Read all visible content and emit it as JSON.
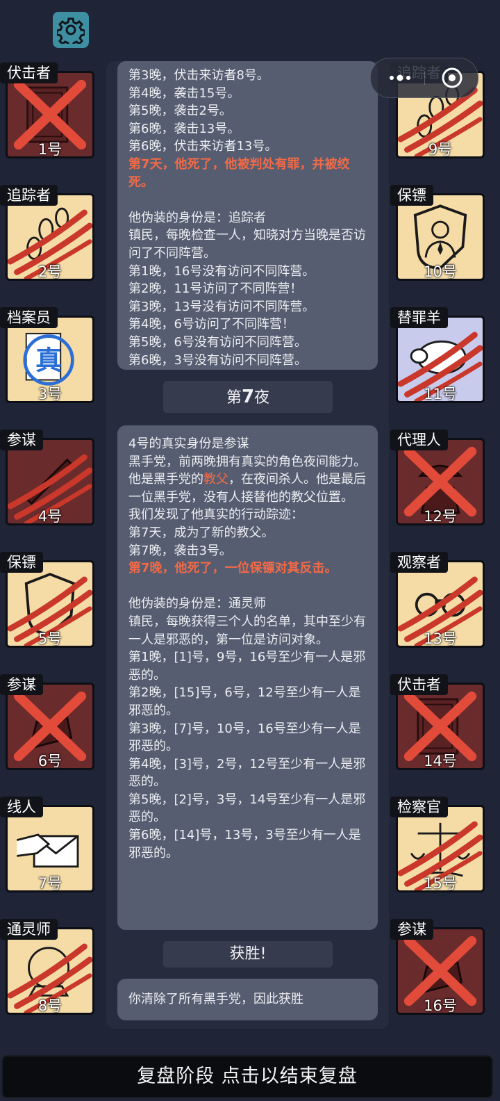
{
  "left_cards": [
    {
      "role": "伏击者",
      "num": "1号",
      "art": "door",
      "dead": true,
      "status": "x",
      "bg": "#6a2b2c"
    },
    {
      "role": "追踪者",
      "num": "2号",
      "art": "footprints",
      "dead": true,
      "status": "claw",
      "bg": "#f5dca7"
    },
    {
      "role": "档案员",
      "num": "3号",
      "art": "stamp",
      "dead": false,
      "status": "",
      "bg": "#f5dca7"
    },
    {
      "role": "参谋",
      "num": "4号",
      "art": "dagger",
      "dead": true,
      "status": "claw",
      "bg": "#6a2b2c"
    },
    {
      "role": "保镖",
      "num": "5号",
      "art": "shield",
      "dead": true,
      "status": "claw",
      "bg": "#f5dca7"
    },
    {
      "role": "参谋",
      "num": "6号",
      "art": "hand",
      "dead": true,
      "status": "x",
      "bg": "#6a2b2c"
    },
    {
      "role": "线人",
      "num": "7号",
      "art": "envelope",
      "dead": false,
      "status": "",
      "bg": "#f5dca7"
    },
    {
      "role": "通灵师",
      "num": "8号",
      "art": "crystal",
      "dead": true,
      "status": "claw",
      "bg": "#f5dca7"
    }
  ],
  "right_cards": [
    {
      "role": "追踪者",
      "num": "9号",
      "art": "footprints",
      "dead": true,
      "status": "claw",
      "bg": "#f5dca7"
    },
    {
      "role": "保镖",
      "num": "10号",
      "art": "shield-person",
      "dead": false,
      "status": "",
      "bg": "#f5dca7"
    },
    {
      "role": "替罪羊",
      "num": "11号",
      "art": "sheep",
      "dead": true,
      "status": "claw",
      "bg": "#c9cbed"
    },
    {
      "role": "代理人",
      "num": "12号",
      "art": "agent",
      "dead": true,
      "status": "x",
      "bg": "#6a2b2c"
    },
    {
      "role": "观察者",
      "num": "13号",
      "art": "binoculars",
      "dead": true,
      "status": "claw",
      "bg": "#f5dca7"
    },
    {
      "role": "伏击者",
      "num": "14号",
      "art": "door",
      "dead": true,
      "status": "x",
      "bg": "#6a2b2c"
    },
    {
      "role": "检察官",
      "num": "15号",
      "art": "scales",
      "dead": true,
      "status": "claw",
      "bg": "#f5dca7"
    },
    {
      "role": "参谋",
      "num": "16号",
      "art": "hand",
      "dead": true,
      "status": "x",
      "bg": "#6a2b2c"
    }
  ],
  "box1": {
    "lines": [
      "第3晚，伏击来访者8号。",
      "第4晚，袭击15号。",
      "第5晚，袭击2号。",
      "第6晚，袭击13号。",
      "第6晚，伏击来访者13号。"
    ],
    "death": "第7天，他死了，他被判处有罪，并被绞死。",
    "disguise": "他伪装的身份是：追踪者",
    "desc": "镇民，每晚检查一人，知晓对方当晚是否访问了不同阵营。",
    "results": [
      "第1晚，16号没有访问不同阵营。",
      "第2晚，11号访问了不同阵营！",
      "第3晚，13号没有访问不同阵营。",
      "第4晚，6号访问了不同阵营！",
      "第5晚，6号没有访问不同阵营。",
      "第6晚，3号没有访问不同阵营。"
    ]
  },
  "night_title": {
    "pre": "第",
    "num": "7",
    "post": "夜"
  },
  "box2": {
    "identity": "4号的真实身份是参谋",
    "desc": "黑手党，前两晚拥有真实的角色夜间能力。",
    "godfather_pre": "他是黑手党的",
    "godfather_role": "教父",
    "godfather_post": "，在夜间杀人。他是最后一位黑手党，没有人接替他的教父位置。",
    "trace_intro": "我们发现了他真实的行动踪迹：",
    "trace": [
      "第7天，成为了新的教父。",
      "第7晚，袭击3号。"
    ],
    "death": "第7晚，他死了，一位保镖对其反击。",
    "disguise": "他伪装的身份是：通灵师",
    "disguise_desc": "镇民，每晚获得三个人的名单，其中至少有一人是邪恶的，第一位是访问对象。",
    "results": [
      "第1晚，[1]号，9号，16号至少有一人是邪恶的。",
      "第2晚，[15]号，6号，12号至少有一人是邪恶的。",
      "第3晚，[7]号，10号，16号至少有一人是邪恶的。",
      "第4晚，[3]号，2号，12号至少有一人是邪恶的。",
      "第5晚，[2]号，3号，14号至少有一人是邪恶的。",
      "第6晚，[14]号，13号，3号至少有一人是邪恶的。"
    ]
  },
  "win_title": "获胜!",
  "win_text": "你清除了所有黑手党，因此获胜",
  "bottom_bar": "复盘阶段 点击以结束复盘",
  "icons": {
    "settings": "gear-icon",
    "more": "more-dots-icon",
    "close": "close-circle-icon"
  },
  "colors": {
    "accent": "#f26a47",
    "claw": "#c9382a",
    "cross": "#e24b3a",
    "evil_bg": "#6a2b2c",
    "good_bg": "#f5dca7"
  }
}
